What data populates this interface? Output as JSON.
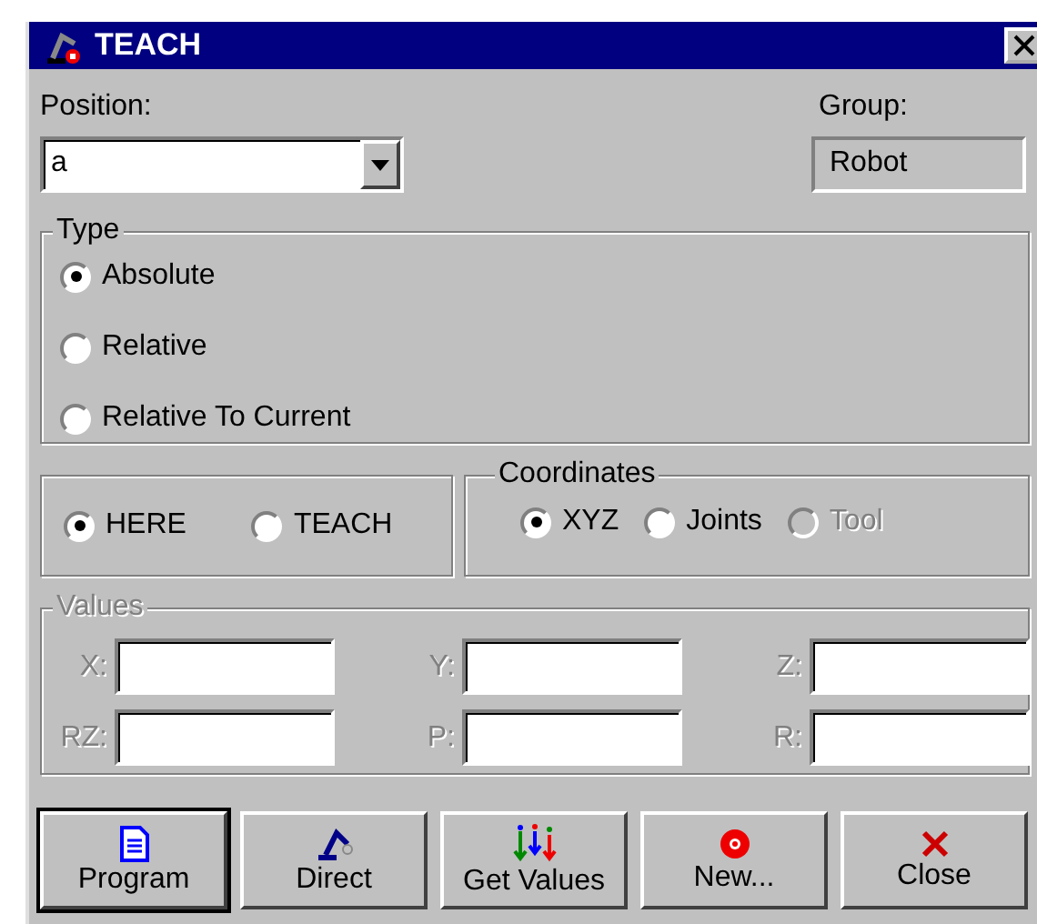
{
  "window": {
    "title": "TEACH"
  },
  "position": {
    "label": "Position:",
    "value": "a"
  },
  "group": {
    "label": "Group:",
    "value": "Robot"
  },
  "type": {
    "title": "Type",
    "options": [
      {
        "label": "Absolute",
        "selected": true
      },
      {
        "label": "Relative",
        "selected": false
      },
      {
        "label": "Relative To Current",
        "selected": false
      }
    ]
  },
  "mode": {
    "options": [
      {
        "label": "HERE",
        "selected": true
      },
      {
        "label": "TEACH",
        "selected": false
      }
    ]
  },
  "coordinates": {
    "title": "Coordinates",
    "options": [
      {
        "label": "XYZ",
        "selected": true,
        "disabled": false
      },
      {
        "label": "Joints",
        "selected": false,
        "disabled": false
      },
      {
        "label": "Tool",
        "selected": false,
        "disabled": true
      }
    ]
  },
  "values": {
    "title": "Values",
    "disabled": true,
    "fields": [
      {
        "label": "X:"
      },
      {
        "label": "Y:"
      },
      {
        "label": "Z:"
      },
      {
        "label": "RZ:"
      },
      {
        "label": "P:"
      },
      {
        "label": "R:"
      }
    ]
  },
  "buttons": [
    {
      "label": "Program",
      "kind": "document",
      "default": true
    },
    {
      "label": "Direct",
      "kind": "robot",
      "default": false
    },
    {
      "label": "Get Values",
      "kind": "arrows",
      "default": false
    },
    {
      "label": "New...",
      "kind": "new",
      "default": false
    },
    {
      "label": "Close",
      "kind": "close",
      "default": false
    }
  ]
}
